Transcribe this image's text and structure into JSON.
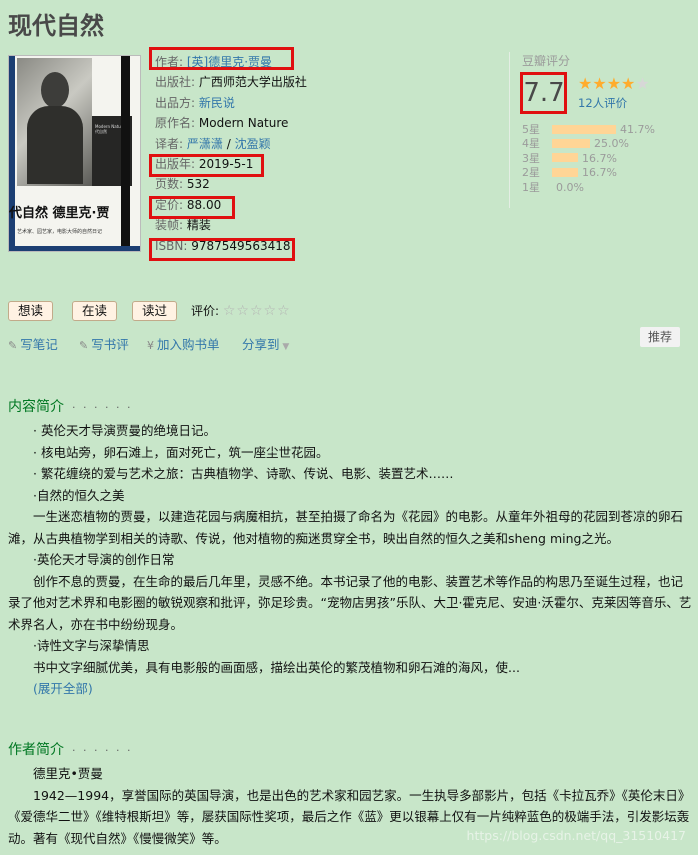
{
  "book": {
    "title": "现代自然",
    "cover": {
      "title_line": "代自然  德里克·贾",
      "subtitle_line": "艺术家、园艺家，电影大师的自然日记",
      "box_text": "Modern Nature 现代自然"
    },
    "info": {
      "author_label": "作者:",
      "author": "[英]德里克·贾曼",
      "publisher_label": "出版社:",
      "publisher": "广西师范大学出版社",
      "producer_label": "出品方:",
      "producer": "新民说",
      "original_title_label": "原作名:",
      "original_title": "Modern Nature",
      "translator_label": "译者:",
      "translator1": "严潇潇",
      "translator_sep": " / ",
      "translator2": "沈盈颖",
      "pubdate_label": "出版年:",
      "pubdate": "2019-5-1",
      "pages_label": "页数:",
      "pages": "532",
      "price_label": "定价:",
      "price": "88.00",
      "binding_label": "装帧:",
      "binding": "精装",
      "isbn_label": "ISBN:",
      "isbn": "9787549563418"
    }
  },
  "rating": {
    "label": "豆瓣评分",
    "score": "7.7",
    "stars_on": "★★★★",
    "stars_off": "★",
    "count_text": "12人评价",
    "bar_color": "#ffd596",
    "distribution": [
      {
        "label": "5星",
        "percent": 41.7,
        "percent_text": "41.7%"
      },
      {
        "label": "4星",
        "percent": 25.0,
        "percent_text": "25.0%"
      },
      {
        "label": "3星",
        "percent": 16.7,
        "percent_text": "16.7%"
      },
      {
        "label": "2星",
        "percent": 16.7,
        "percent_text": "16.7%"
      },
      {
        "label": "1星",
        "percent": 0.0,
        "percent_text": "0.0%"
      }
    ]
  },
  "actions": {
    "want_label": "想读",
    "reading_label": "在读",
    "read_label": "读过",
    "evaluate_label": "评价:",
    "evaluate_stars": "☆☆☆☆☆"
  },
  "links": {
    "write_note": "写笔记",
    "write_review": "写书评",
    "add_cart": "加入购书单",
    "share": "分享到",
    "recommend": "推荐"
  },
  "intro": {
    "heading": "内容简介",
    "dots": "· · · · · ·",
    "lines": [
      "· 英伦天才导演贾曼的绝境日记。",
      "· 核电站旁，卵石滩上，面对死亡，筑一座尘世花园。",
      "· 繁花缠绕的爱与艺术之旅：古典植物学、诗歌、传说、电影、装置艺术……",
      "·自然的恒久之美"
    ],
    "p1": "一生迷恋植物的贾曼，以建造花园与病魔相抗，甚至拍摄了命名为《花园》的电影。从童年外祖母的花园到苍凉的卵石滩，从古典植物学到相关的诗歌、传说，他对植物的痴迷贯穿全书，映出自然的恒久之美和sheng ming之光。",
    "sub2": "·英伦天才导演的创作日常",
    "p2": "创作不息的贾曼，在生命的最后几年里，灵感不绝。本书记录了他的电影、装置艺术等作品的构思乃至诞生过程，也记录了他对艺术界和电影圈的敏锐观察和批评，弥足珍贵。“宠物店男孩”乐队、大卫·霍克尼、安迪·沃霍尔、克莱因等音乐、艺术界名人，亦在书中纷纷现身。",
    "sub3": "·诗性文字与深挚情思",
    "p3": "书中文字细腻优美，具有电影般的画面感，描绘出英伦的繁茂植物和卵石滩的海风，使...",
    "expand": "(展开全部)"
  },
  "author_intro": {
    "heading": "作者简介",
    "dots": "· · · · · ·",
    "name": "德里克•贾曼",
    "bio": "1942—1994，享誉国际的英国导演，也是出色的艺术家和园艺家。一生执导多部影片，包括《卡拉瓦乔》《英伦末日》《爱德华二世》《维特根斯坦》等，屡获国际性奖项，最后之作《蓝》更以银幕上仅有一片纯粹蓝色的极端手法，引发影坛轰动。著有《现代自然》《慢慢微笑》等。"
  },
  "watermark": "https://blog.csdn.net/qq_31510417"
}
